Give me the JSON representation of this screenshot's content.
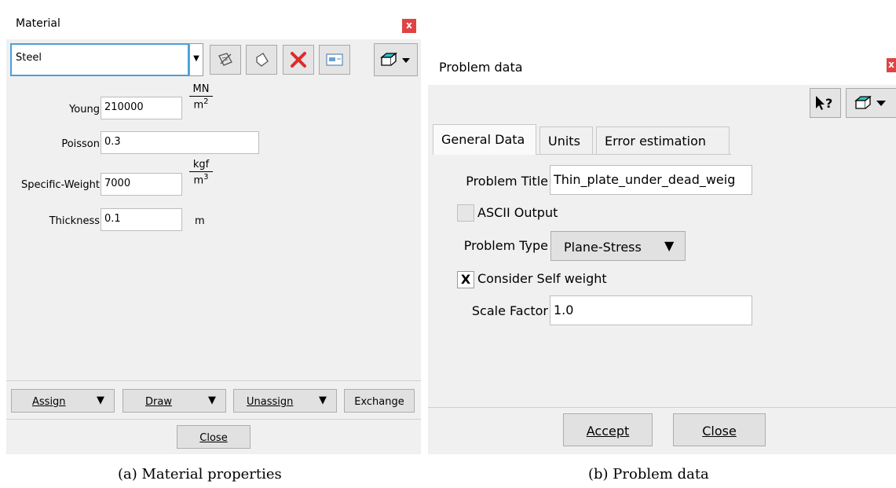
{
  "material": {
    "title": "Material",
    "close_glyph": "x",
    "selected_material": "Steel",
    "toolbar_icons": [
      "edit-material-icon",
      "new-material-icon",
      "delete-icon",
      "rename-icon",
      "import-export-icon"
    ],
    "fields": {
      "young": {
        "label": "Young",
        "value": "210000",
        "unit_num": "MN",
        "unit_den": "m2"
      },
      "poisson": {
        "label": "Poisson",
        "value": "0.3"
      },
      "specific_weight": {
        "label": "Specific-Weight",
        "value": "7000",
        "unit_num": "kgf",
        "unit_den": "m3"
      },
      "thickness": {
        "label": "Thickness",
        "value": "0.1",
        "unit": "m"
      }
    },
    "buttons": {
      "assign": "Assign",
      "draw": "Draw",
      "unassign": "Unassign",
      "exchange": "Exchange",
      "close": "Close"
    },
    "caption": "(a)  Material properties"
  },
  "problem": {
    "title": "Problem data",
    "close_glyph": "x",
    "tabs": [
      "General Data",
      "Units",
      "Error estimation"
    ],
    "problem_title": {
      "label": "Problem Title",
      "value": "Thin_plate_under_dead_weig"
    },
    "ascii_output": {
      "label": "ASCII Output",
      "checked": false
    },
    "problem_type": {
      "label": "Problem Type",
      "value": "Plane-Stress"
    },
    "self_weight": {
      "label": "Consider Self weight",
      "checked": true,
      "mark": "X"
    },
    "scale_factor": {
      "label": "Scale Factor",
      "value": "1.0"
    },
    "buttons": {
      "accept": "Accept",
      "close": "Close"
    },
    "caption": "(b)  Problem data"
  }
}
